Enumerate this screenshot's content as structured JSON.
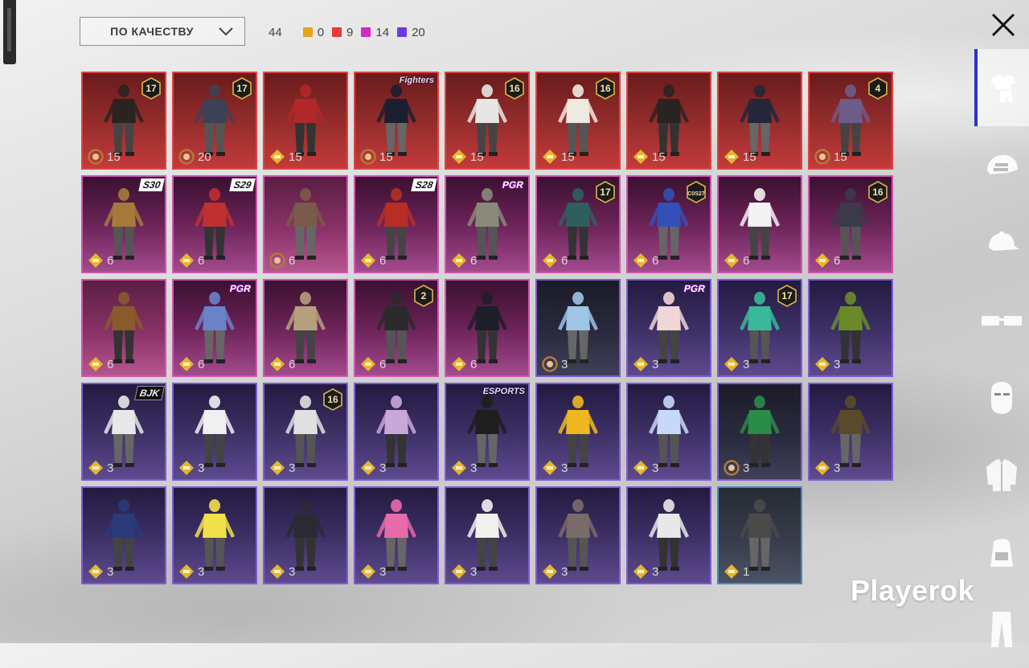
{
  "filter": {
    "sort_label": "ПО КАЧЕСТВУ",
    "total": "44"
  },
  "quality_counts": [
    {
      "color": "#e8a21c",
      "value": "0"
    },
    {
      "color": "#e83a3a",
      "value": "9"
    },
    {
      "color": "#d42ac4",
      "value": "14"
    },
    {
      "color": "#6a3be0",
      "value": "20"
    }
  ],
  "tabs": [
    "outfit-icon",
    "helmet-icon",
    "cap-icon",
    "glasses-icon",
    "mask-icon",
    "jacket-icon",
    "backpack-icon",
    "pants-icon"
  ],
  "items": [
    {
      "rarity": "legend",
      "count": "15",
      "coin": "bronze",
      "level": "17",
      "tag": "",
      "color": "#2a2320"
    },
    {
      "rarity": "legend",
      "count": "20",
      "coin": "bronze",
      "level": "17",
      "tag": "",
      "color": "#3c4256"
    },
    {
      "rarity": "legend",
      "count": "15",
      "coin": "gold",
      "level": "",
      "tag": "",
      "color": "#b02828"
    },
    {
      "rarity": "legend",
      "count": "15",
      "coin": "bronze",
      "level": "",
      "tag": "Fighters",
      "color": "#1c1f30"
    },
    {
      "rarity": "legend",
      "count": "15",
      "coin": "gold",
      "level": "16",
      "tag": "",
      "color": "#e6e6e6"
    },
    {
      "rarity": "legend",
      "count": "15",
      "coin": "gold",
      "level": "16",
      "tag": "",
      "color": "#efeae0"
    },
    {
      "rarity": "legend",
      "count": "15",
      "coin": "gold",
      "level": "",
      "tag": "",
      "color": "#2b2222"
    },
    {
      "rarity": "legend",
      "count": "15",
      "coin": "gold",
      "level": "",
      "tag": "",
      "color": "#26263a"
    },
    {
      "rarity": "legend",
      "count": "15",
      "coin": "bronze",
      "level": "4",
      "tag": "",
      "color": "#6c5c8a"
    },
    {
      "rarity": "epic",
      "count": "6",
      "coin": "gold",
      "level": "",
      "tag": "S30",
      "color": "#a57a3a"
    },
    {
      "rarity": "epic",
      "count": "6",
      "coin": "gold",
      "level": "",
      "tag": "S29",
      "color": "#c03030"
    },
    {
      "rarity": "epic2",
      "count": "6",
      "coin": "bronze",
      "level": "",
      "tag": "",
      "color": "#7a5a48"
    },
    {
      "rarity": "epic",
      "count": "6",
      "coin": "gold",
      "level": "",
      "tag": "S28",
      "color": "#b82d25"
    },
    {
      "rarity": "epic",
      "count": "6",
      "coin": "gold",
      "level": "",
      "tag": "PGR",
      "color": "#8a8a7a"
    },
    {
      "rarity": "epic",
      "count": "6",
      "coin": "gold",
      "level": "17",
      "tag": "",
      "color": "#2e5f5e"
    },
    {
      "rarity": "epic",
      "count": "6",
      "coin": "gold",
      "level": "C0S27",
      "tag": "",
      "color": "#3250b8"
    },
    {
      "rarity": "epic",
      "count": "6",
      "coin": "gold",
      "level": "",
      "tag": "",
      "color": "#f2f2f2"
    },
    {
      "rarity": "epic",
      "count": "6",
      "coin": "gold",
      "level": "16",
      "tag": "",
      "color": "#3a3a4a"
    },
    {
      "rarity": "epic2",
      "count": "6",
      "coin": "gold",
      "level": "",
      "tag": "",
      "color": "#8a5a2a"
    },
    {
      "rarity": "epic",
      "count": "6",
      "coin": "gold",
      "level": "",
      "tag": "PGR",
      "color": "#6a82c8"
    },
    {
      "rarity": "epic",
      "count": "6",
      "coin": "gold",
      "level": "",
      "tag": "",
      "color": "#b4a07a"
    },
    {
      "rarity": "epic",
      "count": "6",
      "coin": "gold",
      "level": "2",
      "tag": "",
      "color": "#2a2a2a"
    },
    {
      "rarity": "epic",
      "count": "6",
      "coin": "gold",
      "level": "",
      "tag": "",
      "color": "#1e1e2a"
    },
    {
      "rarity": "dark",
      "count": "3",
      "coin": "bronze",
      "level": "",
      "tag": "",
      "color": "#9ec4e6"
    },
    {
      "rarity": "rare",
      "count": "3",
      "coin": "gold",
      "level": "",
      "tag": "PGR",
      "color": "#f0d6d6"
    },
    {
      "rarity": "rare",
      "count": "3",
      "coin": "gold",
      "level": "17",
      "tag": "",
      "color": "#39b89a"
    },
    {
      "rarity": "rare",
      "count": "3",
      "coin": "gold",
      "level": "",
      "tag": "",
      "color": "#6a8a2a"
    },
    {
      "rarity": "rare",
      "count": "3",
      "coin": "gold",
      "level": "",
      "tag": "BJK",
      "color": "#e8e8e8"
    },
    {
      "rarity": "rare",
      "count": "3",
      "coin": "gold",
      "level": "",
      "tag": "",
      "color": "#f0f0f0"
    },
    {
      "rarity": "rare",
      "count": "3",
      "coin": "gold",
      "level": "16",
      "tag": "",
      "color": "#e0e0e0"
    },
    {
      "rarity": "rare",
      "count": "3",
      "coin": "gold",
      "level": "",
      "tag": "",
      "color": "#c8a8d8"
    },
    {
      "rarity": "rare",
      "count": "3",
      "coin": "gold",
      "level": "",
      "tag": "ESPORTS",
      "color": "#1e1e1e"
    },
    {
      "rarity": "rare",
      "count": "3",
      "coin": "gold",
      "level": "",
      "tag": "",
      "color": "#f0b820"
    },
    {
      "rarity": "rare",
      "count": "3",
      "coin": "gold",
      "level": "",
      "tag": "",
      "color": "#c8d8f8"
    },
    {
      "rarity": "dark",
      "count": "3",
      "coin": "bronze",
      "level": "",
      "tag": "",
      "color": "#2a8a48"
    },
    {
      "rarity": "rare",
      "count": "3",
      "coin": "gold",
      "level": "",
      "tag": "",
      "color": "#5a4a2a"
    },
    {
      "rarity": "rare",
      "count": "3",
      "coin": "gold",
      "level": "",
      "tag": "",
      "color": "#2a3a7a"
    },
    {
      "rarity": "rare",
      "count": "3",
      "coin": "gold",
      "level": "",
      "tag": "",
      "color": "#f2e04a"
    },
    {
      "rarity": "rare",
      "count": "3",
      "coin": "gold",
      "level": "",
      "tag": "",
      "color": "#2a2a34"
    },
    {
      "rarity": "rare",
      "count": "3",
      "coin": "gold",
      "level": "",
      "tag": "",
      "color": "#e86aa8"
    },
    {
      "rarity": "rare",
      "count": "3",
      "coin": "gold",
      "level": "",
      "tag": "",
      "color": "#f0f0f0"
    },
    {
      "rarity": "rare",
      "count": "3",
      "coin": "gold",
      "level": "",
      "tag": "",
      "color": "#7a6a6a"
    },
    {
      "rarity": "rare",
      "count": "3",
      "coin": "gold",
      "level": "",
      "tag": "",
      "color": "#e8e8e8"
    },
    {
      "rarity": "grey",
      "count": "1",
      "coin": "gold",
      "level": "",
      "tag": "",
      "color": "#4a4a4a"
    }
  ],
  "watermark": "Playerok"
}
